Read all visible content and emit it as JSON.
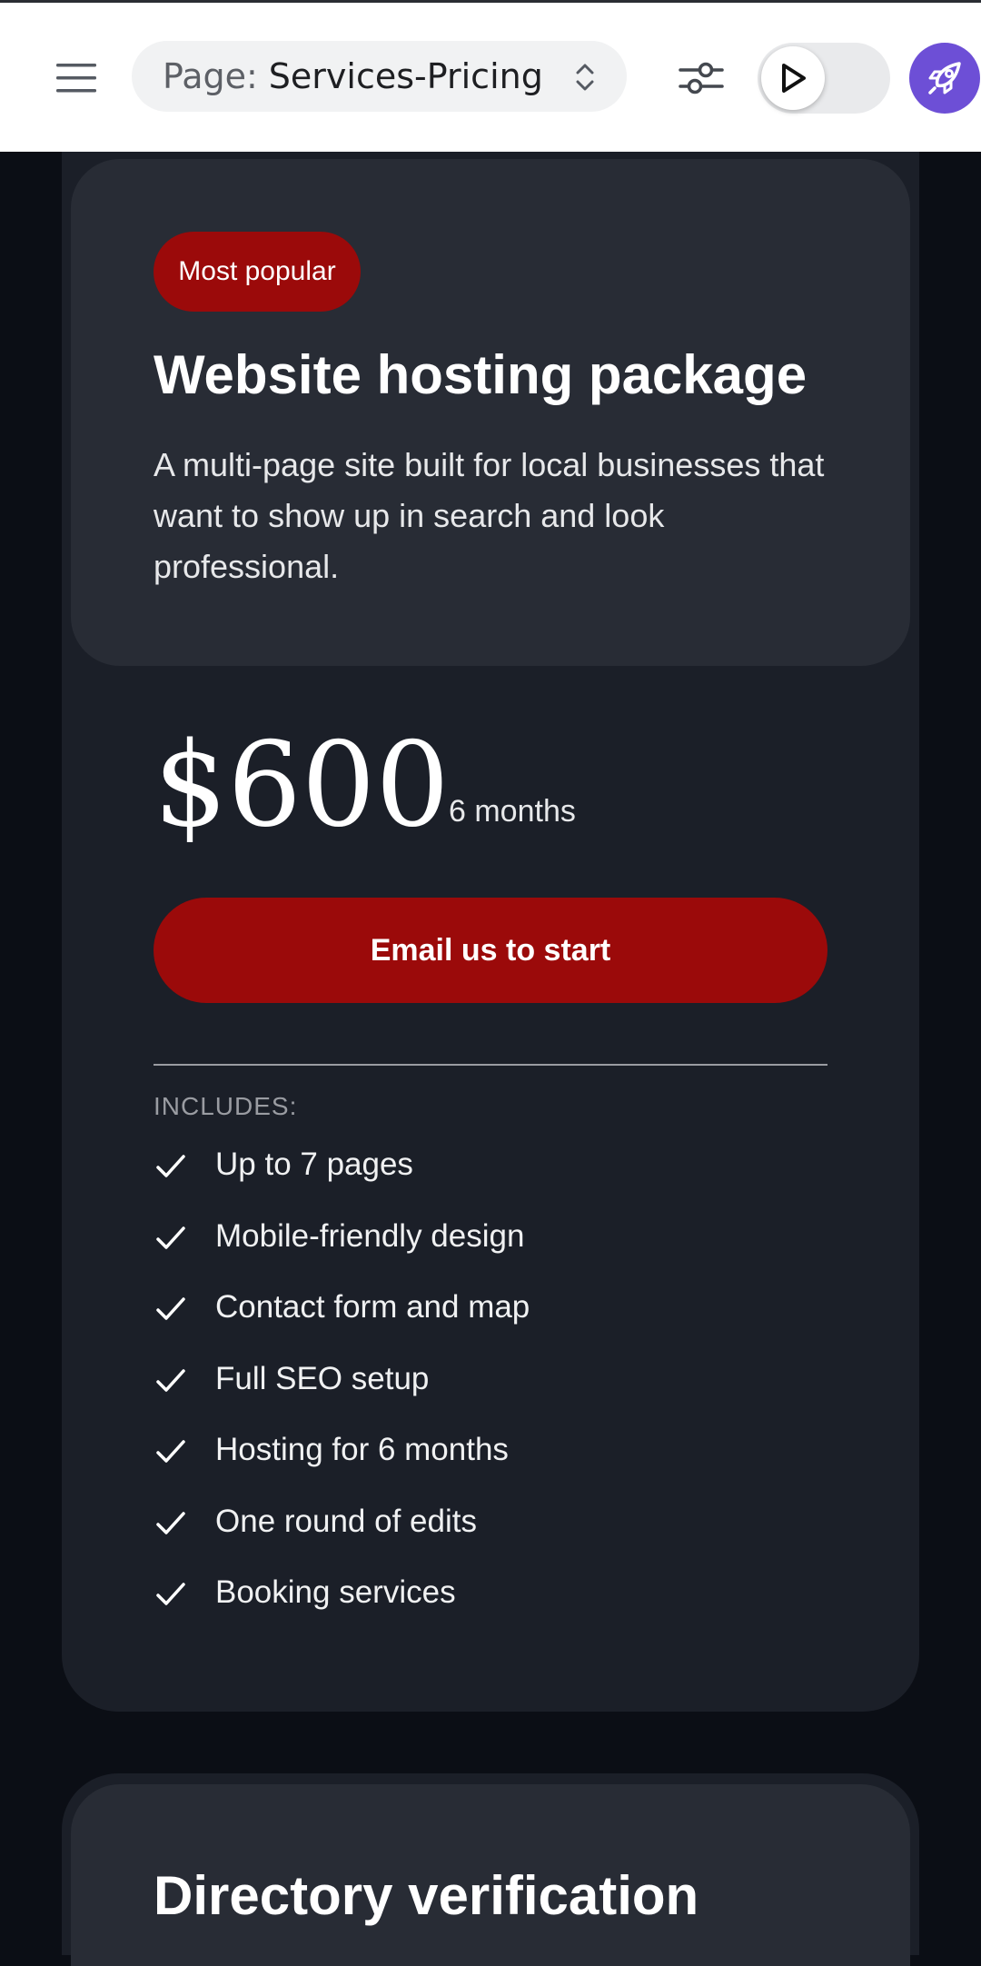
{
  "topbar": {
    "page_prefix": "Page:",
    "page_name": "Services-Pricing",
    "icons": {
      "menu": "hamburger-menu-icon",
      "selector": "chevron-up-down-icon",
      "settings": "sliders-icon",
      "preview": "play-icon",
      "launch": "rocket-icon"
    },
    "launch_color": "#6d4fd6"
  },
  "plan": {
    "badge": "Most popular",
    "title": "Website hosting package",
    "description": "A multi-page site built for local businesses that want to show up in search and look professional.",
    "price": "$600",
    "period": "6 months",
    "cta_label": "Email us to start",
    "includes_label": "INCLUDES:",
    "features": [
      "Up to 7 pages",
      "Mobile-friendly design",
      "Contact form and map",
      "Full SEO setup",
      "Hosting for 6 months",
      "One round of edits",
      "Booking services"
    ],
    "accent_color": "#9b0a0a"
  },
  "next_plan": {
    "title": "Directory verification"
  }
}
